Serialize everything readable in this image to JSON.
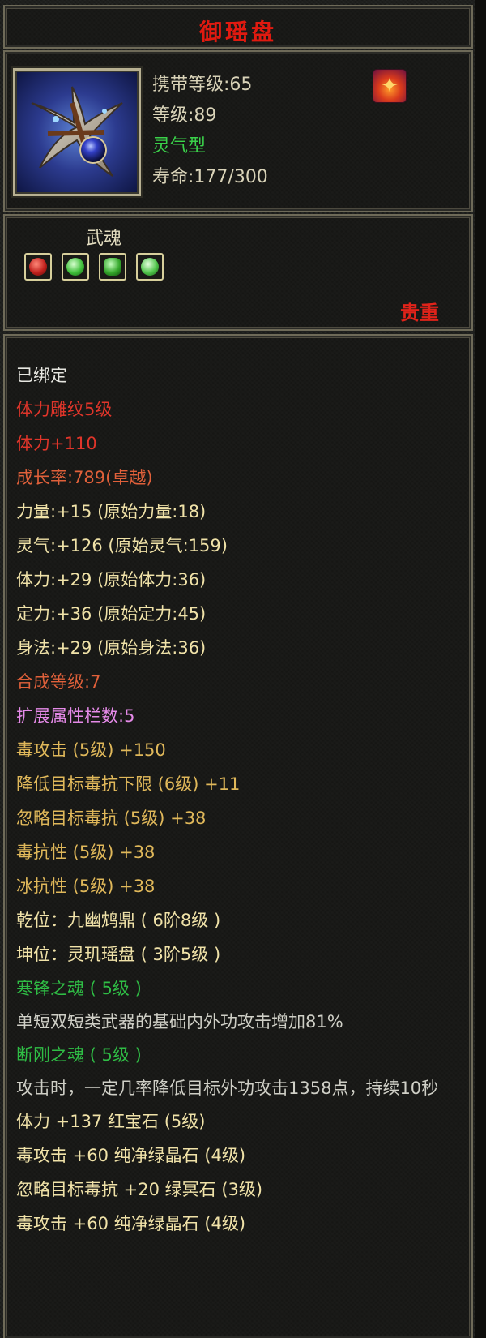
{
  "header": {
    "title": "御瑶盘"
  },
  "item_info": {
    "carry_level": "携带等级:65",
    "level": "等级:89",
    "type": "灵气型",
    "lifespan": "寿命:177/300",
    "icon_name": "cross-shuriken-orb-icon",
    "badge_icon": "flame-icon"
  },
  "soul": {
    "title": "武魂",
    "gems": [
      {
        "icon": "red-gem-icon",
        "color": "#c0201c"
      },
      {
        "icon": "green-gem-icon",
        "color": "#3fbf3a"
      },
      {
        "icon": "green-gem-icon",
        "color": "#35a82c"
      },
      {
        "icon": "green-gem-icon",
        "color": "#4fc44a"
      }
    ],
    "rarity": "贵重"
  },
  "stats": [
    {
      "text": "已绑定",
      "color": "white"
    },
    {
      "text": "体力雕纹5级",
      "color": "red"
    },
    {
      "text": "体力+110",
      "color": "red"
    },
    {
      "text": "成长率:789(卓越)",
      "color": "orange"
    },
    {
      "text": "力量:+15 (原始力量:18)",
      "color": "yellow"
    },
    {
      "text": "灵气:+126 (原始灵气:159)",
      "color": "yellow"
    },
    {
      "text": "体力:+29 (原始体力:36)",
      "color": "yellow"
    },
    {
      "text": "定力:+36 (原始定力:45)",
      "color": "yellow"
    },
    {
      "text": "身法:+29 (原始身法:36)",
      "color": "yellow"
    },
    {
      "text": "合成等级:7",
      "color": "orange"
    },
    {
      "text": "扩展属性栏数:5",
      "color": "pink"
    },
    {
      "text": "毒攻击 (5级) +150",
      "color": "gold"
    },
    {
      "text": "降低目标毒抗下限 (6级) +11",
      "color": "gold"
    },
    {
      "text": "忽略目标毒抗 (5级) +38",
      "color": "gold"
    },
    {
      "text": "毒抗性 (5级) +38",
      "color": "gold"
    },
    {
      "text": "冰抗性 (5级) +38",
      "color": "gold"
    },
    {
      "text": "乾位：九幽鸩鼎 ( 6阶8级 )",
      "color": "yellow"
    },
    {
      "text": "坤位：灵玑瑶盘 ( 3阶5级 )",
      "color": "yellow"
    },
    {
      "text": "寒锋之魂 ( 5级 )",
      "color": "green"
    },
    {
      "text": "单短双短类武器的基础内外功攻击增加81%",
      "color": "gray",
      "desc": true
    },
    {
      "text": "断刚之魂 ( 5级 )",
      "color": "green"
    },
    {
      "text": "攻击时，一定几率降低目标外功攻击1358点，持续10秒",
      "color": "gray",
      "desc": true
    },
    {
      "text": "体力 +137 红宝石 (5级)",
      "color": "yellow"
    },
    {
      "text": "毒攻击 +60 纯净绿晶石 (4级)",
      "color": "yellow"
    },
    {
      "text": "忽略目标毒抗 +20 绿冥石 (3级)",
      "color": "yellow"
    },
    {
      "text": "毒攻击 +60 纯净绿晶石 (4级)",
      "color": "yellow"
    }
  ]
}
